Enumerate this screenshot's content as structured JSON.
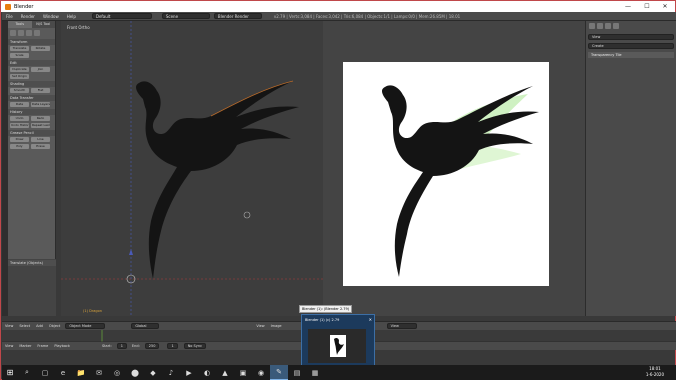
{
  "window": {
    "title": "Blender",
    "controls": {
      "minimize": "—",
      "maximize": "☐",
      "close": "✕"
    }
  },
  "menubar": {
    "items": [
      "File",
      "Render",
      "Window",
      "Help"
    ],
    "layout": "Default",
    "scene": "Scene",
    "engine": "Blender Render",
    "status": "v2.79 | Verts:3,084 | Faces:3,042 | Tris:6,084 | Objects:1/1 | Lamps:0/0 | Mem:26.85M | 18.01"
  },
  "tool_panel": {
    "tabs": [
      "Tools",
      "N/S Tool"
    ],
    "sections": [
      {
        "header": "Transform",
        "buttons": [
          "Translate",
          "Rotate",
          "Scale"
        ]
      },
      {
        "header": "Edit",
        "buttons": [
          "Duplicate",
          "Join",
          "Set Origin"
        ]
      },
      {
        "header": "Shading",
        "buttons": [
          "Smooth",
          "Flat"
        ]
      },
      {
        "header": "Data Transfer",
        "buttons": [
          "Data",
          "Data Layers"
        ]
      },
      {
        "header": "History",
        "buttons": [
          "Undo",
          "Redo",
          "Undo History",
          "Repeat Last"
        ]
      },
      {
        "header": "Grease Pencil",
        "buttons": [
          "Draw",
          "Line",
          "Poly",
          "Erase"
        ]
      }
    ],
    "footer": "Translate (Objects)"
  },
  "viewport": {
    "label": "Front Ortho",
    "object_label": "(1) Dragon"
  },
  "image_editor": {
    "image_name": "image.png"
  },
  "right_panel": {
    "field1": "View",
    "field2": "Create",
    "selected": "Transparency Tile"
  },
  "header_bar": {
    "items": [
      "View",
      "Select",
      "Add",
      "Object"
    ],
    "mode": "Object Mode",
    "pivot": "Global",
    "img_items": [
      "View",
      "Image",
      "Image"
    ],
    "image_field": "Image",
    "view_field": "View"
  },
  "timeline": {
    "items": [
      "View",
      "Marker",
      "Frame",
      "Playback"
    ],
    "start_label": "Start:",
    "start": "1",
    "end_label": "End:",
    "end": "250",
    "current": "1",
    "sync": "No Sync"
  },
  "tooltip": {
    "text": "Blender (1): (Blender 2.79)"
  },
  "thumbnail": {
    "title": "Blender (1) (c) 2.79"
  },
  "taskbar": {
    "start_glyph": "⊞",
    "apps": [
      "⌕",
      "▢",
      "e",
      "📁",
      "✉",
      "◎",
      "⬤",
      "◆",
      "♪",
      "▶",
      "◐",
      "▲",
      "▣",
      "◉",
      "✎",
      "▤",
      "▦"
    ],
    "time": "18:01",
    "date": "1-6-2020"
  },
  "colors": {
    "chrome": "#393939",
    "panel": "#4a4a4a",
    "dragon": "#141414",
    "wing_glow": "#a8e68f",
    "axis_red": "#b03a3a",
    "axis_blue": "#4a5ab8",
    "window_border": "#c0474a",
    "taskbar": "#1b1b1b"
  }
}
